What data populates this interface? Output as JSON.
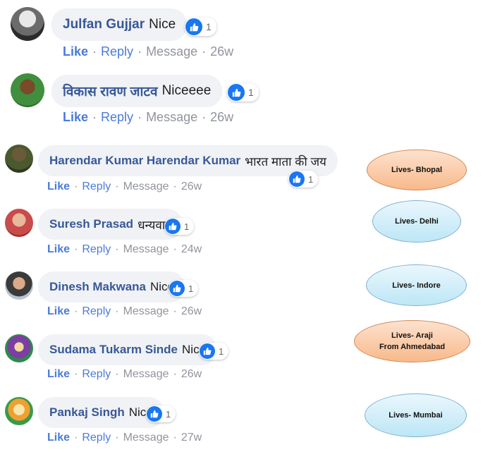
{
  "comments": [
    {
      "name": "Julfan Gujjar",
      "text": "Nice",
      "count": "1",
      "time": "26w"
    },
    {
      "name": "विकास रावण जाटव",
      "text": "Niceeee",
      "count": "1",
      "time": "26w"
    },
    {
      "name": "Harendar Kumar Harendar Kumar",
      "text": "भारत माता की जय",
      "count": "1",
      "time": "26w"
    },
    {
      "name": "Suresh Prasad",
      "text": "धन्यवाद",
      "count": "1",
      "time": "24w"
    },
    {
      "name": "Dinesh Makwana",
      "text": "Nice",
      "count": "1",
      "time": "26w"
    },
    {
      "name": "Sudama Tukarm Sinde",
      "text": "Nice",
      "count": "1",
      "time": "26w"
    },
    {
      "name": "Pankaj Singh",
      "text": "Nice",
      "count": "1",
      "time": "27w"
    }
  ],
  "actions": {
    "like": "Like",
    "reply": "Reply",
    "message": "Message",
    "sep": "·"
  },
  "notes": {
    "bhopal": "Lives- Bhopal",
    "delhi": "Lives- Delhi",
    "indore": "Lives- Indore",
    "araji_1": "Lives- Araji",
    "araji_2": "From Ahmedabad",
    "mumbai": "Lives- Mumbai"
  },
  "colors": {
    "name": "#385898",
    "link": "#4b7bd8",
    "like_badge": "#1877f2",
    "bubble": "#f0f2f5"
  }
}
